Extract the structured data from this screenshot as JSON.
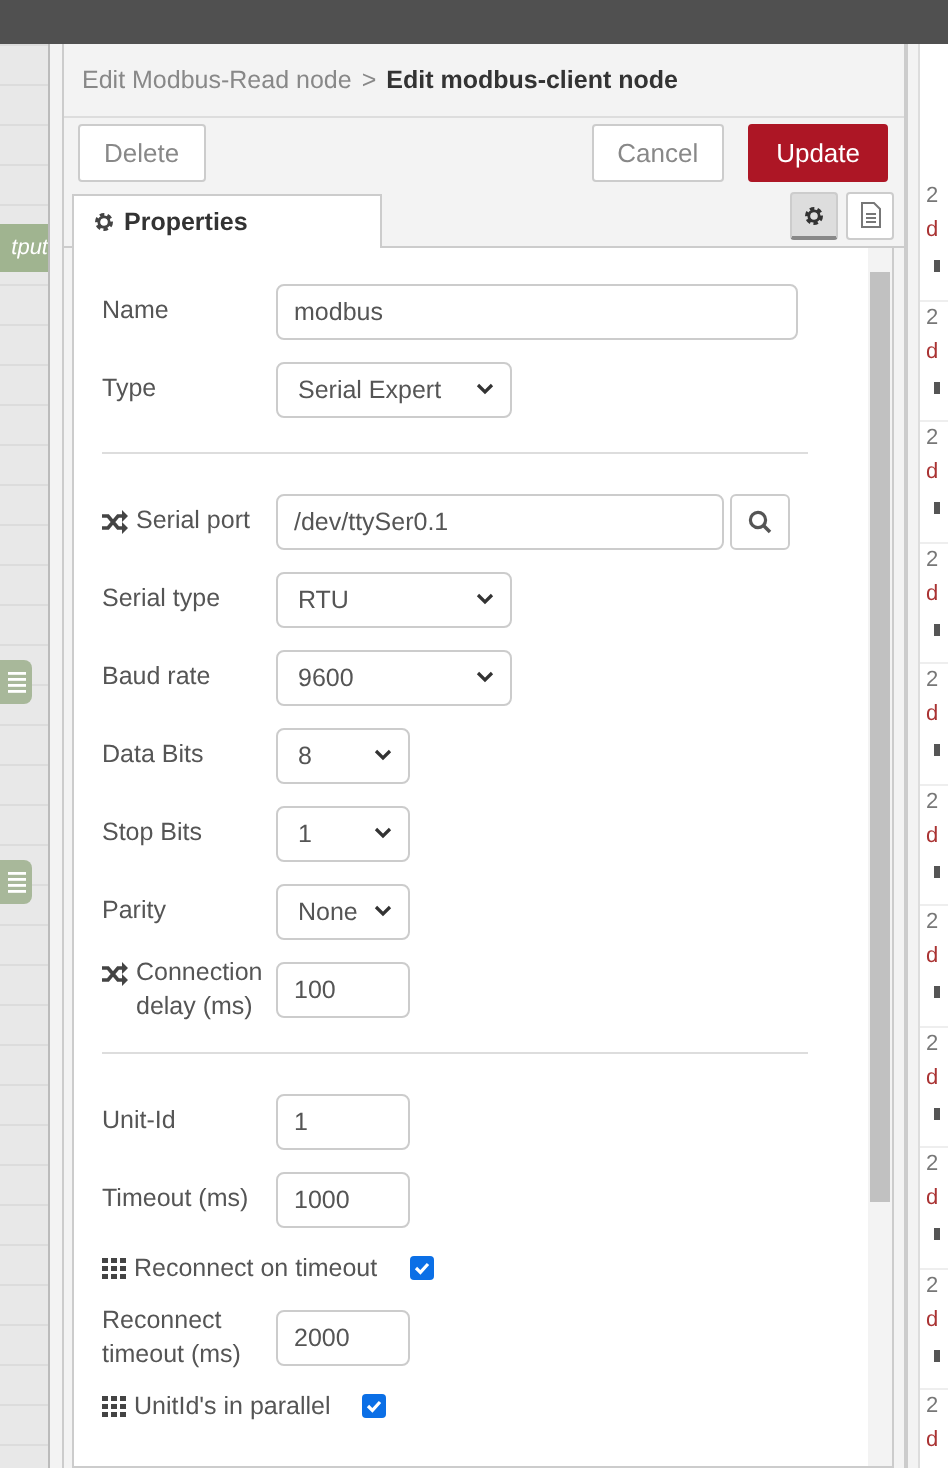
{
  "canvas": {
    "node_label": "tput"
  },
  "breadcrumb": {
    "parent": "Edit Modbus-Read node",
    "separator": ">",
    "current": "Edit modbus-client node"
  },
  "buttons": [
    {
      "label": "Delete",
      "kind": "plain"
    },
    {
      "label": "Cancel",
      "kind": "plain"
    },
    {
      "label": "Update",
      "kind": "primary"
    }
  ],
  "tabs": [
    {
      "label": "Properties",
      "selected": true
    }
  ],
  "fields": [
    {
      "kind": "wide-text",
      "label": "Name",
      "value": "modbus",
      "icon": false
    },
    {
      "kind": "select",
      "label": "Type",
      "value": "Serial Expert",
      "icon": false
    },
    {
      "kind": "divider"
    },
    {
      "kind": "port",
      "label": "Serial port",
      "value": "/dev/ttySer0.1",
      "icon": true
    },
    {
      "kind": "select",
      "label": "Serial type",
      "value": "RTU",
      "icon": false
    },
    {
      "kind": "select",
      "label": "Baud rate",
      "value": "9600",
      "icon": false
    },
    {
      "kind": "short-select",
      "label": "Data Bits",
      "value": "8",
      "icon": false
    },
    {
      "kind": "short-select",
      "label": "Stop Bits",
      "value": "1",
      "icon": false
    },
    {
      "kind": "short-select",
      "label": "Parity",
      "value": "None",
      "icon": false
    },
    {
      "kind": "text",
      "label": "Connection delay (ms)",
      "value": "100",
      "icon": true
    },
    {
      "kind": "divider"
    },
    {
      "kind": "text",
      "label": "Unit-Id",
      "value": "1",
      "icon": false
    },
    {
      "kind": "text",
      "label": "Timeout (ms)",
      "value": "1000",
      "icon": false
    },
    {
      "kind": "checkbox",
      "label": "Reconnect on timeout",
      "checked": true,
      "icon": true
    },
    {
      "kind": "text",
      "label": "Reconnect timeout (ms)",
      "value": "2000",
      "icon": false
    },
    {
      "kind": "checkbox",
      "label": "UnitId's in parallel",
      "checked": true,
      "icon": true
    }
  ],
  "debug_entries": [
    {
      "line_1": "2",
      "line_2": "d"
    },
    {
      "line_1": "2",
      "line_2": "d"
    },
    {
      "line_1": "2",
      "line_2": "d"
    },
    {
      "line_1": "2",
      "line_2": "d"
    },
    {
      "line_1": "2",
      "line_2": "d"
    },
    {
      "line_1": "2",
      "line_2": "d"
    },
    {
      "line_1": "2",
      "line_2": "d"
    },
    {
      "line_1": "2",
      "line_2": "d"
    },
    {
      "line_1": "2",
      "line_2": "d"
    },
    {
      "line_1": "2",
      "line_2": "d"
    },
    {
      "line_1": "2",
      "line_2": "d"
    }
  ]
}
